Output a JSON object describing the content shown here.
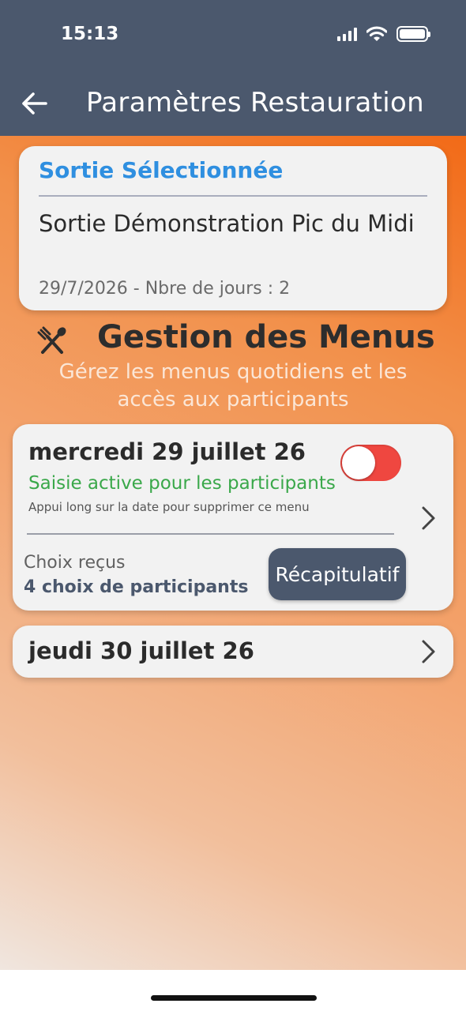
{
  "status_bar": {
    "time": "15:13",
    "icons": [
      "signal-icon",
      "wifi-icon",
      "battery-icon"
    ]
  },
  "header": {
    "title": "Paramètres Restauration",
    "back_icon": "arrow-left-icon"
  },
  "sortie": {
    "header": "Sortie Sélectionnée",
    "name": "Sortie Démonstration Pic du Midi",
    "meta": "29/7/2026 - Nbre de jours : 2"
  },
  "menus": {
    "icon": "utensils-icon",
    "title": "Gestion des Menus",
    "subtitle": "Gérez les menus quotidiens et les accès aux participants"
  },
  "days": [
    {
      "date": "mercredi 29 juillet 26",
      "status": "Saisie active pour les participants",
      "hint": "Appui long sur la date pour supprimer ce menu",
      "choix_label": "Choix reçus",
      "choix_count": "4 choix de participants",
      "recap_label": "Récapitulatif",
      "toggle_on": true
    },
    {
      "date": "jeudi 30 juillet 26"
    }
  ],
  "colors": {
    "header_bg": "#4b586d",
    "accent_blue": "#2f8fe0",
    "status_green": "#3aa84a",
    "toggle_red": "#ef4740",
    "gradient_top": "#f26a17",
    "gradient_bottom": "#f0e6df"
  }
}
